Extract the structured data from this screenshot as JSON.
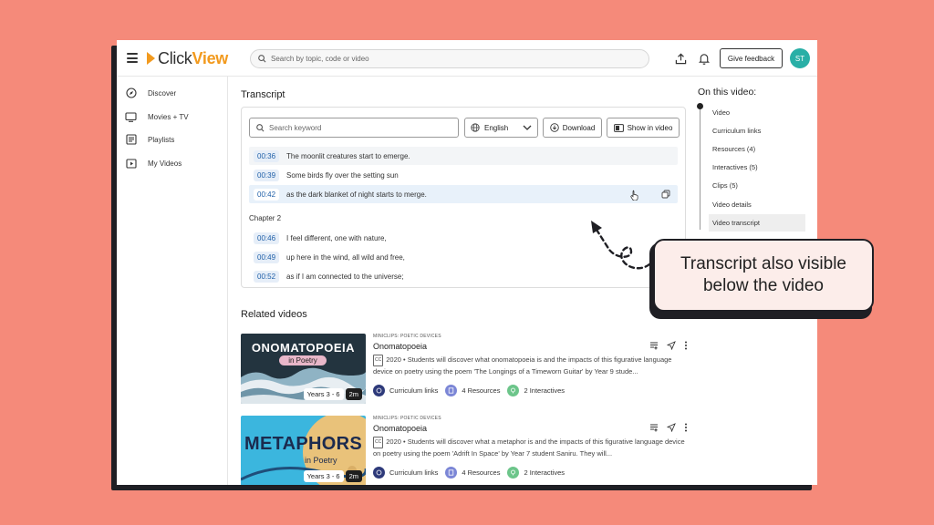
{
  "header": {
    "logo_text_a": "Click",
    "logo_text_b": "View",
    "search_placeholder": "Search by topic, code or video",
    "feedback_label": "Give feedback",
    "avatar_initials": "ST"
  },
  "sidebar": {
    "items": [
      {
        "label": "Discover",
        "icon": "compass-icon"
      },
      {
        "label": "Movies + TV",
        "icon": "tv-icon"
      },
      {
        "label": "Playlists",
        "icon": "playlist-icon"
      },
      {
        "label": "My Videos",
        "icon": "play-square-icon"
      }
    ]
  },
  "transcript": {
    "title": "Transcript",
    "keyword_placeholder": "Search keyword",
    "language": "English",
    "download_label": "Download",
    "show_in_video_label": "Show in video",
    "lines": [
      {
        "time": "00:36",
        "text": "The moonlit creatures start to emerge."
      },
      {
        "time": "00:39",
        "text": "Some birds fly over the setting sun"
      },
      {
        "time": "00:42",
        "text": "as the dark blanket of night starts to merge."
      }
    ],
    "chapter_label": "Chapter 2",
    "chapter_lines": [
      {
        "time": "00:46",
        "text": "I feel different, one with nature,"
      },
      {
        "time": "00:49",
        "text": "up here in the wind, all wild and free,"
      },
      {
        "time": "00:52",
        "text": "as if I am connected to the universe;"
      }
    ]
  },
  "related": {
    "title": "Related videos",
    "videos": [
      {
        "tag": "MINICLIPS: POETIC DEVICES",
        "title": "Onomatopoeia",
        "cc": "CC",
        "description": "2020 • Students will discover what onomatopoeia is and the impacts of this figurative language device on poetry using the poem 'The Longings of a Timeworn Guitar' by Year 9 stude...",
        "years": "Years 3 - 6",
        "duration": "2m",
        "thumb_title": "ONOMATOPOEIA",
        "thumb_sub": "in Poetry",
        "curriculum": "Curriculum links",
        "resources": "4 Resources",
        "interactives": "2 Interactives"
      },
      {
        "tag": "MINICLIPS: POETIC DEVICES",
        "title": "Onomatopoeia",
        "cc": "CC",
        "description": "2020 • Students will discover what a metaphor is and the impacts of this figurative language device on poetry using the poem 'Adrift In Space' by Year 7 student Saniru. They will...",
        "years": "Years 3 - 6",
        "duration": "2m",
        "thumb_title": "METAPHORS",
        "thumb_sub": "in Poetry",
        "curriculum": "Curriculum links",
        "resources": "4 Resources",
        "interactives": "2 Interactives"
      }
    ]
  },
  "toc": {
    "title": "On this video:",
    "items": [
      {
        "label": "Video"
      },
      {
        "label": "Curriculum links"
      },
      {
        "label": "Resources (4)"
      },
      {
        "label": "Interactives (5)"
      },
      {
        "label": "Clips (5)"
      },
      {
        "label": "Video details"
      },
      {
        "label": "Video transcript"
      }
    ]
  },
  "callout": {
    "line1": "Transcript also visible",
    "line2": "below the video"
  },
  "colors": {
    "background": "#F58A7A",
    "brand_orange": "#F29A1E",
    "avatar_teal": "#29AFA6"
  }
}
